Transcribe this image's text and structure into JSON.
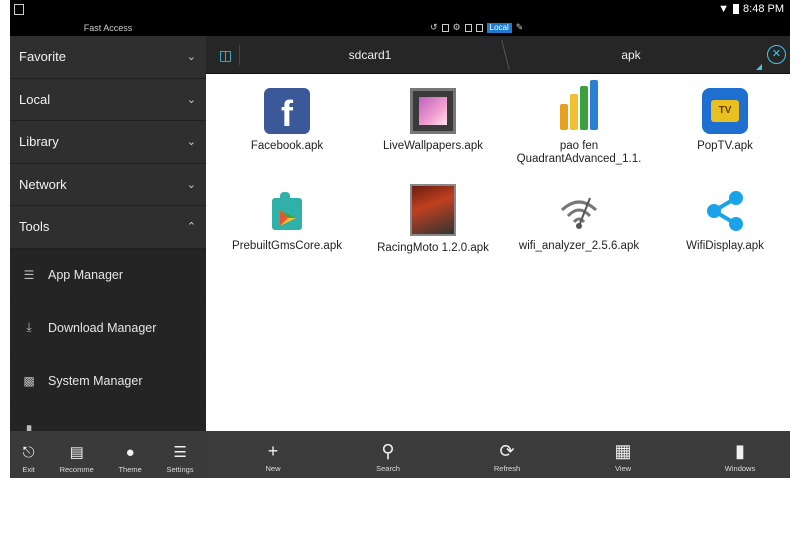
{
  "status_bar": {
    "time": "8:48 PM"
  },
  "sub_header": {
    "fast_access": "Fast Access",
    "local_chip": "Local"
  },
  "sidebar": {
    "groups": [
      {
        "label": "Favorite"
      },
      {
        "label": "Local"
      },
      {
        "label": "Library"
      },
      {
        "label": "Network"
      },
      {
        "label": "Tools"
      }
    ],
    "tools": [
      {
        "label": "App Manager"
      },
      {
        "label": "Download Manager"
      },
      {
        "label": "System Manager"
      }
    ],
    "bottom": [
      {
        "label": "Exit"
      },
      {
        "label": "Recomme"
      },
      {
        "label": "Theme"
      },
      {
        "label": "Settings"
      }
    ]
  },
  "path": {
    "crumb_1": "sdcard1",
    "crumb_2": "apk"
  },
  "files": [
    {
      "name": "Facebook.apk",
      "icon": "facebook-icon"
    },
    {
      "name": "LiveWallpapers.apk",
      "icon": "live-wallpapers-icon"
    },
    {
      "name": "pao fen QuadrantAdvanced_1.1.",
      "icon": "quadrant-icon"
    },
    {
      "name": "PopTV.apk",
      "icon": "poptv-icon"
    },
    {
      "name": "PrebuiltGmsCore.apk",
      "icon": "gms-core-icon"
    },
    {
      "name": "RacingMoto 1.2.0.apk",
      "icon": "racing-moto-icon"
    },
    {
      "name": "wifi_analyzer_2.5.6.apk",
      "icon": "wifi-analyzer-icon"
    },
    {
      "name": "WifiDisplay.apk",
      "icon": "wifi-display-icon"
    }
  ],
  "toolbar": [
    {
      "label": "New"
    },
    {
      "label": "Search"
    },
    {
      "label": "Refresh"
    },
    {
      "label": "View"
    },
    {
      "label": "Windows"
    }
  ],
  "colors": {
    "accent": "#3fc7e8",
    "sidebar": "#2b2b2b",
    "toolbar": "#3b3b3b"
  }
}
